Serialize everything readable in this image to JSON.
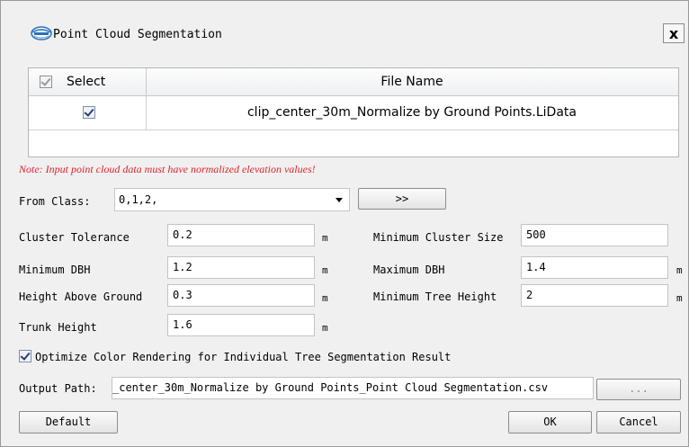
{
  "dialog": {
    "title": "Point Cloud Segmentation",
    "close_label": "x"
  },
  "table": {
    "select_header": "Select",
    "file_header": "File Name",
    "rows": [
      {
        "selected": true,
        "file": "clip_center_30m_Normalize by Ground Points.LiData"
      }
    ]
  },
  "note": "Note: Input point cloud data must have normalized elevation values!",
  "from_class": {
    "label": "From Class:",
    "value": "0,1,2,",
    "button_label": ">>"
  },
  "params": {
    "cluster_tolerance": {
      "label": "Cluster Tolerance",
      "value": "0.2",
      "unit": "m"
    },
    "minimum_cluster_size": {
      "label": "Minimum Cluster Size",
      "value": "500"
    },
    "minimum_dbh": {
      "label": "Minimum DBH",
      "value": "1.2",
      "unit": "m"
    },
    "maximum_dbh": {
      "label": "Maximum DBH",
      "value": "1.4",
      "unit": "m"
    },
    "height_above_ground": {
      "label": "Height Above Ground",
      "value": "0.3",
      "unit": "m"
    },
    "minimum_tree_height": {
      "label": "Minimum Tree Height",
      "value": "2",
      "unit": "m"
    },
    "trunk_height": {
      "label": "Trunk Height",
      "value": "1.6",
      "unit": "m"
    }
  },
  "optimize": {
    "checked": true,
    "label": "Optimize Color Rendering for Individual Tree Segmentation Result"
  },
  "output": {
    "label": "Output Path:",
    "value": "_center_30m_Normalize by Ground Points_Point Cloud Segmentation.csv",
    "browse_label": "..."
  },
  "buttons": {
    "default": "Default",
    "ok": "OK",
    "cancel": "Cancel"
  },
  "colors": {
    "note": "#e0232a",
    "background": "#f0f0f0"
  }
}
